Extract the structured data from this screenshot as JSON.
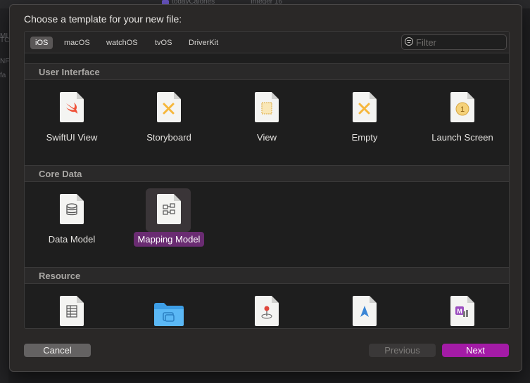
{
  "background": {
    "entity_text": "todayCalories",
    "type_text": "Integer 16",
    "side_labels": [
      "MI",
      "TC",
      "NF",
      "fa"
    ]
  },
  "dialog": {
    "title": "Choose a template for your new file:",
    "tabs": [
      {
        "label": "iOS",
        "active": true
      },
      {
        "label": "macOS",
        "active": false
      },
      {
        "label": "watchOS",
        "active": false
      },
      {
        "label": "tvOS",
        "active": false
      },
      {
        "label": "DriverKit",
        "active": false
      }
    ],
    "filter": {
      "placeholder": "Filter",
      "value": ""
    },
    "sections": [
      {
        "title": "User Interface",
        "items": [
          {
            "label": "SwiftUI View",
            "icon": "swift-file-icon"
          },
          {
            "label": "Storyboard",
            "icon": "storyboard-file-icon"
          },
          {
            "label": "View",
            "icon": "view-file-icon"
          },
          {
            "label": "Empty",
            "icon": "empty-file-icon"
          },
          {
            "label": "Launch Screen",
            "icon": "launch-screen-file-icon"
          }
        ]
      },
      {
        "title": "Core Data",
        "items": [
          {
            "label": "Data Model",
            "icon": "data-model-file-icon"
          },
          {
            "label": "Mapping Model",
            "icon": "mapping-model-file-icon",
            "selected": true
          }
        ]
      },
      {
        "title": "Resource",
        "items": [
          {
            "label": "",
            "icon": "strings-file-icon"
          },
          {
            "label": "",
            "icon": "asset-catalog-folder-icon"
          },
          {
            "label": "",
            "icon": "gpx-file-icon"
          },
          {
            "label": "",
            "icon": "geojson-file-icon"
          },
          {
            "label": "",
            "icon": "ml-model-file-icon"
          }
        ]
      }
    ],
    "buttons": {
      "cancel": "Cancel",
      "previous": "Previous",
      "next": "Next"
    },
    "colors": {
      "accent": "#a31ba6",
      "selection": "#6a2c72",
      "swift": "#f05138",
      "storyboard": "#f6b73c"
    }
  }
}
